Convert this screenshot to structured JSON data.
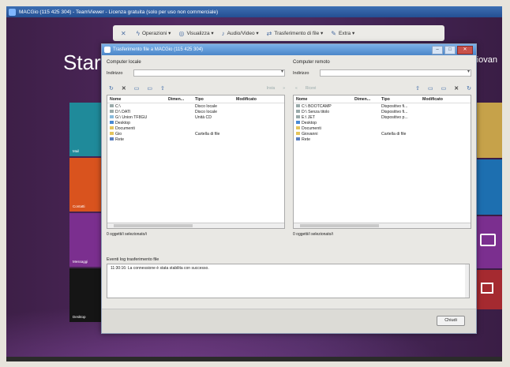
{
  "window": {
    "title": "MACGio (115 425 304) - TeamViewer - Licenza gratuita (solo per uso non commerciale)"
  },
  "toolbar": {
    "items": [
      {
        "icon": "close-icon",
        "label": ""
      },
      {
        "icon": "lightning-icon",
        "label": "Operazioni ▾"
      },
      {
        "icon": "eye-icon",
        "label": "Visualizza ▾"
      },
      {
        "icon": "speaker-icon",
        "label": "Audio/Video ▾"
      },
      {
        "icon": "transfer-icon",
        "label": "Trasferimento di file ▾"
      },
      {
        "icon": "extra-icon",
        "label": "Extra ▾"
      }
    ]
  },
  "desktop": {
    "start_label": "Star",
    "user_name": "Giovan"
  },
  "tiles": [
    {
      "label": "Mail",
      "color": "#1f8a9a"
    },
    {
      "label": "Contatti",
      "color": "#d9531e"
    },
    {
      "label": "Messaggi",
      "color": "#7b2f8f"
    },
    {
      "label": "Desktop",
      "color": "#151515"
    }
  ],
  "dialog": {
    "title": "Trasferimento file a MACGio (115 425 304)",
    "local": {
      "label": "Computer locale",
      "address_label": "Indirizzo",
      "address_value": "",
      "right_tools": "Invia",
      "columns": [
        "Nome",
        "Dimen...",
        "Tipo",
        "Modificato"
      ],
      "rows": [
        {
          "name": "C:\\",
          "size": "",
          "type": "Disco locale",
          "modified": ""
        },
        {
          "name": "D:\\ DATI",
          "size": "",
          "type": "Disco locale",
          "modified": ""
        },
        {
          "name": "G:\\ Union TF8GU",
          "size": "",
          "type": "Unità CD",
          "modified": ""
        },
        {
          "name": "Desktop",
          "size": "",
          "type": "",
          "modified": ""
        },
        {
          "name": "Documenti",
          "size": "",
          "type": "",
          "modified": ""
        },
        {
          "name": "Gio",
          "size": "",
          "type": "Cartella di file",
          "modified": ""
        },
        {
          "name": "Rete",
          "size": "",
          "type": "",
          "modified": ""
        }
      ],
      "status": "0 oggetti/i selezionato/i"
    },
    "remote": {
      "label": "Computer remoto",
      "address_label": "Indirizzo",
      "address_value": "",
      "left_tools": "Ricevi",
      "columns": [
        "Nome",
        "Dimen...",
        "Tipo",
        "Modificato"
      ],
      "rows": [
        {
          "name": "C:\\ BOOTCAMP",
          "size": "",
          "type": "Dispositivo fi...",
          "modified": ""
        },
        {
          "name": "D:\\ Senza titolo",
          "size": "",
          "type": "Dispositivo fi...",
          "modified": ""
        },
        {
          "name": "E:\\ JET",
          "size": "",
          "type": "Dispositivo p...",
          "modified": ""
        },
        {
          "name": "Desktop",
          "size": "",
          "type": "",
          "modified": ""
        },
        {
          "name": "Documenti",
          "size": "",
          "type": "",
          "modified": ""
        },
        {
          "name": "Giovanni",
          "size": "",
          "type": "Cartella di file",
          "modified": ""
        },
        {
          "name": "Rete",
          "size": "",
          "type": "",
          "modified": ""
        }
      ],
      "status": "0 oggetti/i selezionato/i"
    },
    "log": {
      "label": "Eventi log trasferimento file",
      "entry": "11:30:16: La connessione è stata stabilita con successo."
    },
    "close_label": "Chiudi"
  }
}
